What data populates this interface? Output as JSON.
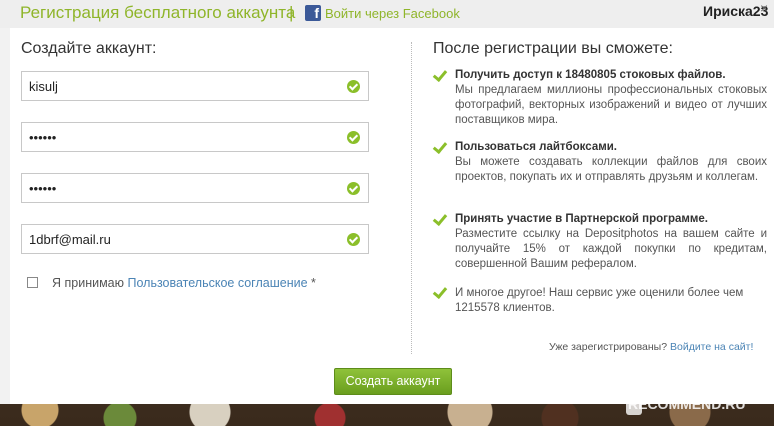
{
  "header": {
    "title": "Регистрация бесплатного аккаунта",
    "separator": "|",
    "facebook_icon": "f",
    "facebook_link": "Войти через Facebook",
    "user": "Ириска23",
    "close": "×"
  },
  "form": {
    "title": "Создайте аккаунт:",
    "fields": [
      {
        "value": "kisulj"
      },
      {
        "value": "••••••"
      },
      {
        "value": "••••••"
      },
      {
        "value": "1dbrf@mail.ru"
      }
    ],
    "agree_prefix": "Я принимаю ",
    "agree_link": "Пользовательское соглашение",
    "agree_suffix": " *",
    "submit": "Создать аккаунт"
  },
  "benefits": {
    "title": "После регистрации вы сможете:",
    "items": [
      {
        "title": "Получить доступ к 18480805 стоковых файлов.",
        "text": "Мы предлагаем миллионы профессиональных стоковых фотографий, векторных изображений и видео от лучших поставщиков мира."
      },
      {
        "title": "Пользоваться лайтбоксами.",
        "text": "Вы можете создавать коллекции файлов для своих проектов, покупать их и отправлять друзьям и коллегам."
      },
      {
        "title": "Принять участие в Партнерской программе.",
        "text": "Разместите ссылку на Depositphotos на вашем сайте и получайте 15% от каждой покупки по кредитам, совершенной Вашим рефералом."
      },
      {
        "title": "",
        "text": "И многое другое! Наш сервис уже оценили более чем 1215578 клиентов."
      }
    ],
    "already_registered": "Уже зарегистрированы?",
    "login_link": "Войдите на сайт!"
  },
  "watermark": "RECOMMEND.RU",
  "colors": {
    "accent": "#8fb52a",
    "link": "#4b84b5",
    "button": "#7ab02c"
  }
}
